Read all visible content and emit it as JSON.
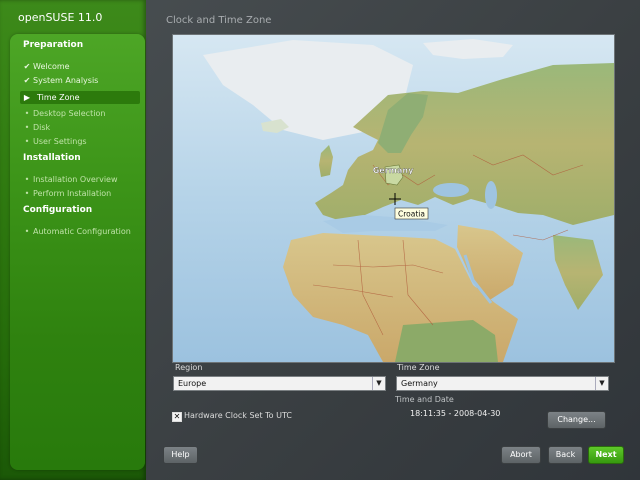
{
  "brand": "openSUSE 11.0",
  "page_title": "Clock and Time Zone",
  "sidebar": {
    "sections": [
      {
        "title": "Preparation",
        "items": [
          {
            "label": "Welcome",
            "state": "done"
          },
          {
            "label": "System Analysis",
            "state": "done"
          },
          {
            "label": "Time Zone",
            "state": "current"
          },
          {
            "label": "Desktop Selection",
            "state": "pending"
          },
          {
            "label": "Disk",
            "state": "pending"
          },
          {
            "label": "User Settings",
            "state": "pending"
          }
        ]
      },
      {
        "title": "Installation",
        "items": [
          {
            "label": "Installation Overview",
            "state": "pending"
          },
          {
            "label": "Perform Installation",
            "state": "pending"
          }
        ]
      },
      {
        "title": "Configuration",
        "items": [
          {
            "label": "Automatic Configuration",
            "state": "pending"
          }
        ]
      }
    ]
  },
  "map": {
    "selected_country": "Germany",
    "hover_country": "Croatia"
  },
  "region": {
    "label": "Region",
    "value": "Europe"
  },
  "timezone": {
    "label": "Time Zone",
    "value": "Germany"
  },
  "time_and_date": {
    "label": "Time and Date",
    "value": "18:11:35 - 2008-04-30"
  },
  "hwclock": {
    "label": "Hardware Clock Set To UTC",
    "checked": true,
    "mark": "✕"
  },
  "buttons": {
    "change": "Change...",
    "help": "Help",
    "abort": "Abort",
    "back": "Back",
    "next": "Next"
  },
  "colors": {
    "brand_green": "#3c9418",
    "next_green": "#36990f"
  }
}
